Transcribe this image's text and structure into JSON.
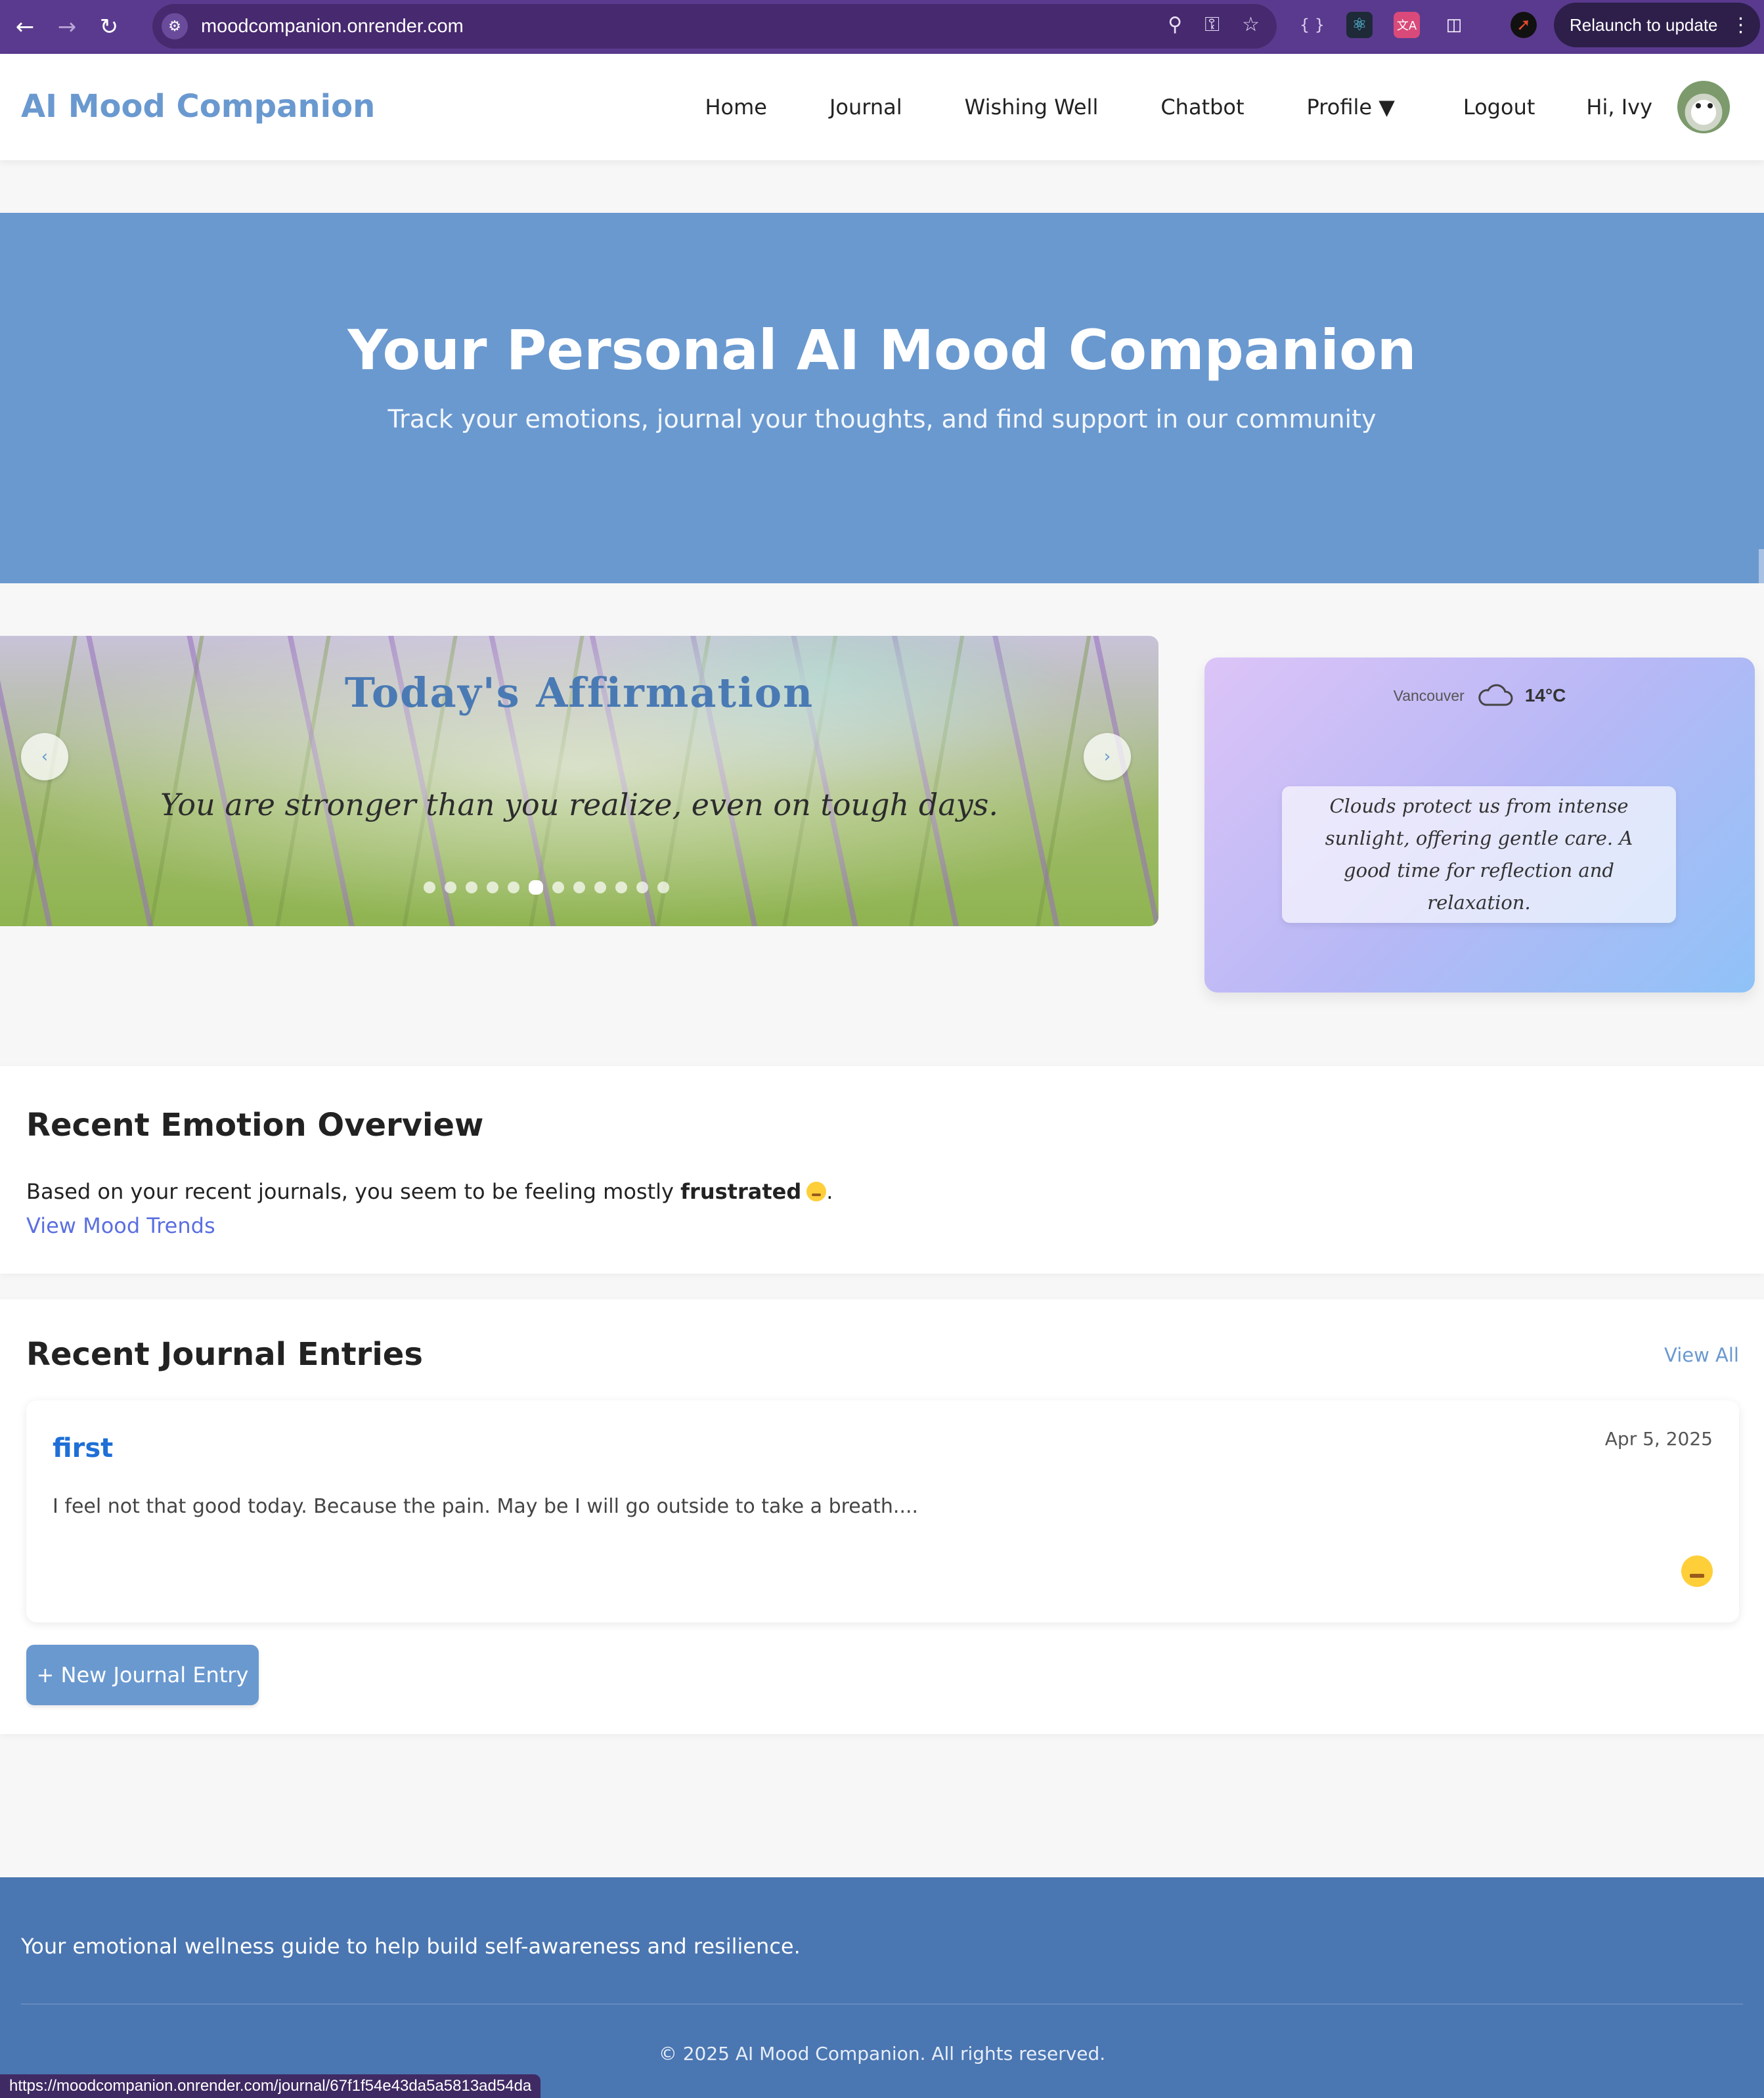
{
  "browser": {
    "url": "moodcompanion.onrender.com",
    "relaunch_label": "Relaunch to update",
    "status_url": "https://moodcompanion.onrender.com/journal/67f1f54e43da5a5813ad54da"
  },
  "navbar": {
    "brand": "AI Mood Companion",
    "links": [
      "Home",
      "Journal",
      "Wishing Well",
      "Chatbot",
      "Profile ▼",
      "Logout"
    ],
    "greeting": "Hi, Ivy"
  },
  "hero": {
    "title": "Your Personal AI Mood Companion",
    "subtitle": "Track your emotions, journal your thoughts, and find support in our community"
  },
  "affirmation": {
    "title": "Today's Affirmation",
    "text": "You are stronger than you realize, even on tough days.",
    "prev_label": "‹",
    "next_label": "›",
    "slide_count": 12,
    "active_index": 5
  },
  "weather": {
    "city": "Vancouver",
    "temperature": "14°C",
    "icon": "cloud-icon",
    "message": "Clouds protect us from intense sunlight, offering gentle care. A good time for reflection and relaxation."
  },
  "emotion_overview": {
    "title": "Recent Emotion Overview",
    "text_before": "Based on your recent journals, you seem to be feeling mostly ",
    "emotion": "frustrated",
    "text_after": ".",
    "trends_link": "View Mood Trends"
  },
  "journal": {
    "title": "Recent Journal Entries",
    "view_all": "View All",
    "entries": [
      {
        "title": "first",
        "date": "Apr 5, 2025",
        "excerpt": "I feel not that good today. Because the pain. May be I will go outside to take a breath....",
        "mood_icon": "frustrated-face-icon"
      }
    ],
    "new_entry_label": "+ New Journal Entry"
  },
  "footer": {
    "tagline": "Your emotional wellness guide to help build self-awareness and resilience.",
    "copyright": "© 2025 AI Mood Companion. All rights reserved."
  },
  "colors": {
    "brand": "#6a99d0",
    "browser_frame": "#5a3a8e",
    "footer": "#4a76b2",
    "link": "#5b6fe0",
    "entry_title": "#1f6fd6"
  }
}
